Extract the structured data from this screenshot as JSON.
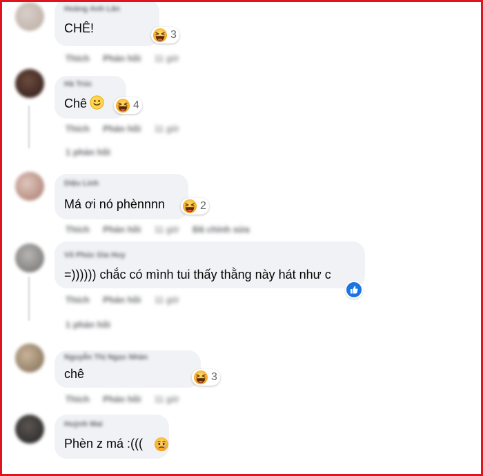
{
  "comments": [
    {
      "author": "Hoàng Anh Lân",
      "text": "CHÊ!",
      "reaction_count": "3",
      "actions": [
        "Thích",
        "Phản hồi",
        "11 giờ"
      ]
    },
    {
      "author": "Hà Trúc",
      "text": "Chê",
      "reaction_count": "4",
      "actions": [
        "Thích",
        "Phản hồi",
        "11 giờ"
      ],
      "replies": "1 phản hồi"
    },
    {
      "author": "Diệu Linh",
      "text": "Má ơi nó phènnnn",
      "reaction_count": "2",
      "actions": [
        "Thích",
        "Phản hồi",
        "11 giờ",
        "Đã chỉnh sửa"
      ]
    },
    {
      "author": "Võ Phúc Gia Huy",
      "text": "=)))))) chắc có mình tui thấy thằng này hát như c",
      "actions": [
        "Thích",
        "Phản hồi",
        "11 giờ"
      ],
      "replies": "1 phản hồi"
    },
    {
      "author": "Nguyễn Thị Ngọc Nhàn",
      "text": "chê",
      "reaction_count": "3",
      "actions": [
        "Thích",
        "Phản hồi",
        "11 giờ"
      ]
    },
    {
      "author": "Huỳnh Mai",
      "text": "Phèn z má :((("
    }
  ],
  "colors": {
    "frame_border": "#e0141e",
    "bubble": "#f0f2f5",
    "haha": "#f7b928",
    "like": "#1b74e4"
  },
  "icons": {
    "haha": "haha-reaction-icon",
    "smile": "smile-emoji-icon",
    "like": "like-reaction-icon",
    "sad": "sad-reaction-icon"
  }
}
